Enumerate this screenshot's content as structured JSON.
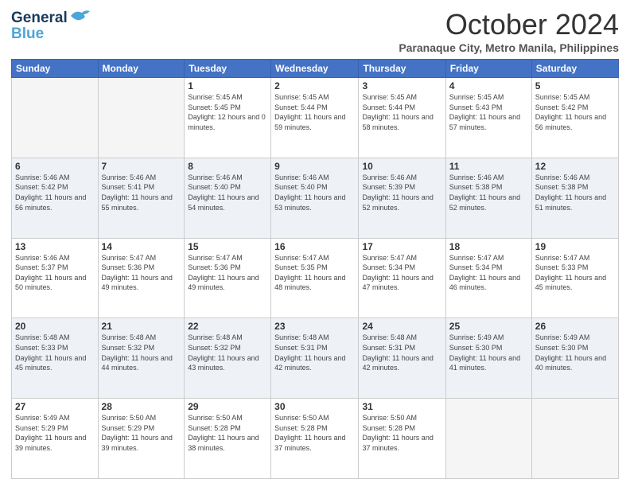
{
  "header": {
    "logo_line1": "General",
    "logo_line2": "Blue",
    "month": "October 2024",
    "location": "Paranaque City, Metro Manila, Philippines"
  },
  "days_of_week": [
    "Sunday",
    "Monday",
    "Tuesday",
    "Wednesday",
    "Thursday",
    "Friday",
    "Saturday"
  ],
  "weeks": [
    [
      {
        "day": "",
        "info": ""
      },
      {
        "day": "",
        "info": ""
      },
      {
        "day": "1",
        "info": "Sunrise: 5:45 AM\nSunset: 5:45 PM\nDaylight: 12 hours and 0 minutes."
      },
      {
        "day": "2",
        "info": "Sunrise: 5:45 AM\nSunset: 5:44 PM\nDaylight: 11 hours and 59 minutes."
      },
      {
        "day": "3",
        "info": "Sunrise: 5:45 AM\nSunset: 5:44 PM\nDaylight: 11 hours and 58 minutes."
      },
      {
        "day": "4",
        "info": "Sunrise: 5:45 AM\nSunset: 5:43 PM\nDaylight: 11 hours and 57 minutes."
      },
      {
        "day": "5",
        "info": "Sunrise: 5:45 AM\nSunset: 5:42 PM\nDaylight: 11 hours and 56 minutes."
      }
    ],
    [
      {
        "day": "6",
        "info": "Sunrise: 5:46 AM\nSunset: 5:42 PM\nDaylight: 11 hours and 56 minutes."
      },
      {
        "day": "7",
        "info": "Sunrise: 5:46 AM\nSunset: 5:41 PM\nDaylight: 11 hours and 55 minutes."
      },
      {
        "day": "8",
        "info": "Sunrise: 5:46 AM\nSunset: 5:40 PM\nDaylight: 11 hours and 54 minutes."
      },
      {
        "day": "9",
        "info": "Sunrise: 5:46 AM\nSunset: 5:40 PM\nDaylight: 11 hours and 53 minutes."
      },
      {
        "day": "10",
        "info": "Sunrise: 5:46 AM\nSunset: 5:39 PM\nDaylight: 11 hours and 52 minutes."
      },
      {
        "day": "11",
        "info": "Sunrise: 5:46 AM\nSunset: 5:38 PM\nDaylight: 11 hours and 52 minutes."
      },
      {
        "day": "12",
        "info": "Sunrise: 5:46 AM\nSunset: 5:38 PM\nDaylight: 11 hours and 51 minutes."
      }
    ],
    [
      {
        "day": "13",
        "info": "Sunrise: 5:46 AM\nSunset: 5:37 PM\nDaylight: 11 hours and 50 minutes."
      },
      {
        "day": "14",
        "info": "Sunrise: 5:47 AM\nSunset: 5:36 PM\nDaylight: 11 hours and 49 minutes."
      },
      {
        "day": "15",
        "info": "Sunrise: 5:47 AM\nSunset: 5:36 PM\nDaylight: 11 hours and 49 minutes."
      },
      {
        "day": "16",
        "info": "Sunrise: 5:47 AM\nSunset: 5:35 PM\nDaylight: 11 hours and 48 minutes."
      },
      {
        "day": "17",
        "info": "Sunrise: 5:47 AM\nSunset: 5:34 PM\nDaylight: 11 hours and 47 minutes."
      },
      {
        "day": "18",
        "info": "Sunrise: 5:47 AM\nSunset: 5:34 PM\nDaylight: 11 hours and 46 minutes."
      },
      {
        "day": "19",
        "info": "Sunrise: 5:47 AM\nSunset: 5:33 PM\nDaylight: 11 hours and 45 minutes."
      }
    ],
    [
      {
        "day": "20",
        "info": "Sunrise: 5:48 AM\nSunset: 5:33 PM\nDaylight: 11 hours and 45 minutes."
      },
      {
        "day": "21",
        "info": "Sunrise: 5:48 AM\nSunset: 5:32 PM\nDaylight: 11 hours and 44 minutes."
      },
      {
        "day": "22",
        "info": "Sunrise: 5:48 AM\nSunset: 5:32 PM\nDaylight: 11 hours and 43 minutes."
      },
      {
        "day": "23",
        "info": "Sunrise: 5:48 AM\nSunset: 5:31 PM\nDaylight: 11 hours and 42 minutes."
      },
      {
        "day": "24",
        "info": "Sunrise: 5:48 AM\nSunset: 5:31 PM\nDaylight: 11 hours and 42 minutes."
      },
      {
        "day": "25",
        "info": "Sunrise: 5:49 AM\nSunset: 5:30 PM\nDaylight: 11 hours and 41 minutes."
      },
      {
        "day": "26",
        "info": "Sunrise: 5:49 AM\nSunset: 5:30 PM\nDaylight: 11 hours and 40 minutes."
      }
    ],
    [
      {
        "day": "27",
        "info": "Sunrise: 5:49 AM\nSunset: 5:29 PM\nDaylight: 11 hours and 39 minutes."
      },
      {
        "day": "28",
        "info": "Sunrise: 5:50 AM\nSunset: 5:29 PM\nDaylight: 11 hours and 39 minutes."
      },
      {
        "day": "29",
        "info": "Sunrise: 5:50 AM\nSunset: 5:28 PM\nDaylight: 11 hours and 38 minutes."
      },
      {
        "day": "30",
        "info": "Sunrise: 5:50 AM\nSunset: 5:28 PM\nDaylight: 11 hours and 37 minutes."
      },
      {
        "day": "31",
        "info": "Sunrise: 5:50 AM\nSunset: 5:28 PM\nDaylight: 11 hours and 37 minutes."
      },
      {
        "day": "",
        "info": ""
      },
      {
        "day": "",
        "info": ""
      }
    ]
  ]
}
